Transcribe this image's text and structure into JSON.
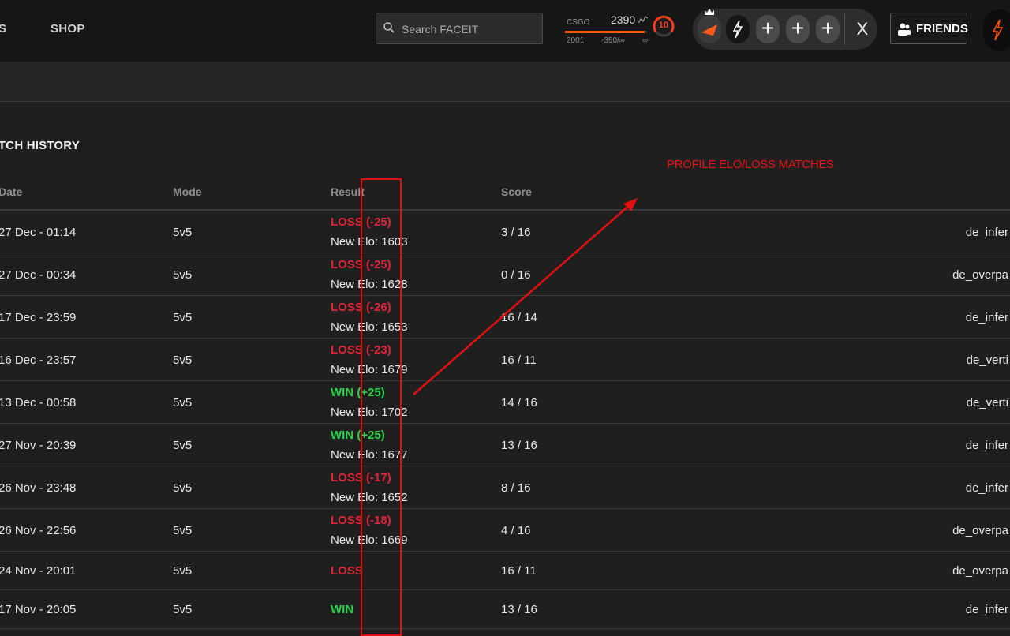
{
  "nav": {
    "partial_item": "S",
    "shop": "SHOP"
  },
  "search": {
    "placeholder": "Search FACEIT"
  },
  "elo_widget": {
    "game": "CSGO",
    "elo": "2390",
    "min": "2001",
    "diff": "-390/∞",
    "max": "∞",
    "level": "10",
    "progress_fraction": 0.97,
    "accent": "#ff5500"
  },
  "party": {
    "slots": [
      "avatar",
      "faceit-bolt",
      "add",
      "add",
      "add"
    ],
    "add_label": "+",
    "close_label": "X"
  },
  "friends_button": {
    "label": "FRIENDS"
  },
  "section": {
    "title": "ATCH HISTORY"
  },
  "columns": {
    "date": "Date",
    "mode": "Mode",
    "result": "Result",
    "score": "Score"
  },
  "matches": [
    {
      "date": "27 Dec - 01:14",
      "mode": "5v5",
      "result": "LOSS (-25)",
      "outcome": "loss",
      "new_elo": "New Elo: 1603",
      "score": "3 / 16",
      "map": "de_infer"
    },
    {
      "date": "27 Dec - 00:34",
      "mode": "5v5",
      "result": "LOSS (-25)",
      "outcome": "loss",
      "new_elo": "New Elo: 1628",
      "score": "0 / 16",
      "map": "de_overpa"
    },
    {
      "date": "17 Dec - 23:59",
      "mode": "5v5",
      "result": "LOSS (-26)",
      "outcome": "loss",
      "new_elo": "New Elo: 1653",
      "score": "16 / 14",
      "map": "de_infer"
    },
    {
      "date": "16 Dec - 23:57",
      "mode": "5v5",
      "result": "LOSS (-23)",
      "outcome": "loss",
      "new_elo": "New Elo: 1679",
      "score": "16 / 11",
      "map": "de_verti"
    },
    {
      "date": "13 Dec - 00:58",
      "mode": "5v5",
      "result": "WIN (+25)",
      "outcome": "win",
      "new_elo": "New Elo: 1702",
      "score": "14 / 16",
      "map": "de_verti"
    },
    {
      "date": "27 Nov - 20:39",
      "mode": "5v5",
      "result": "WIN (+25)",
      "outcome": "win",
      "new_elo": "New Elo: 1677",
      "score": "13 / 16",
      "map": "de_infer"
    },
    {
      "date": "26 Nov - 23:48",
      "mode": "5v5",
      "result": "LOSS (-17)",
      "outcome": "loss",
      "new_elo": "New Elo: 1652",
      "score": "8 / 16",
      "map": "de_infer"
    },
    {
      "date": "26 Nov - 22:56",
      "mode": "5v5",
      "result": "LOSS (-18)",
      "outcome": "loss",
      "new_elo": "New Elo: 1669",
      "score": "4 / 16",
      "map": "de_overpa"
    },
    {
      "date": "24 Nov - 20:01",
      "mode": "5v5",
      "result": "LOSS",
      "outcome": "loss",
      "new_elo": "",
      "score": "16 / 11",
      "map": "de_overpa"
    },
    {
      "date": "17 Nov - 20:05",
      "mode": "5v5",
      "result": "WIN",
      "outcome": "win",
      "new_elo": "",
      "score": "13 / 16",
      "map": "de_infer"
    }
  ],
  "annotation": {
    "text": "PROFILE ELO/LOSS MATCHES",
    "color": "#e01010"
  },
  "colors": {
    "loss": "#e0243a",
    "win": "#2bd44a",
    "background": "#1f1f1f"
  }
}
